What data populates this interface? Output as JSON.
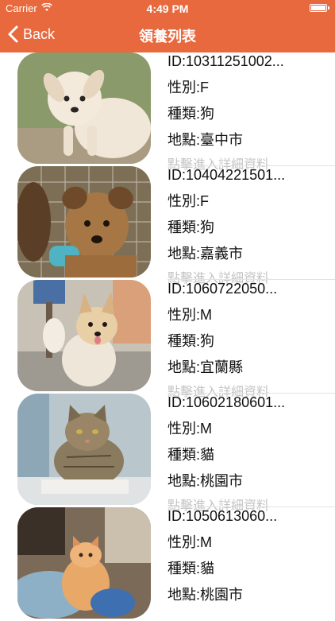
{
  "status_bar": {
    "carrier": "Carrier",
    "time": "4:49 PM"
  },
  "nav": {
    "back_label": "Back",
    "title": "領養列表"
  },
  "colors": {
    "accent": "#e8693e",
    "hint": "#c4c4c4"
  },
  "pets": [
    {
      "id": "ID:10311251002...",
      "sex": "性別:F",
      "kind": "種類:狗",
      "location": "地點:臺中市",
      "hint": "點擊進入詳細資料"
    },
    {
      "id": "ID:10404221501...",
      "sex": "性別:F",
      "kind": "種類:狗",
      "location": "地點:嘉義市",
      "hint": "點擊進入詳細資料"
    },
    {
      "id": "ID:1060722050...",
      "sex": "性別:M",
      "kind": "種類:狗",
      "location": "地點:宜蘭縣",
      "hint": "點擊進入詳細資料"
    },
    {
      "id": "ID:10602180601...",
      "sex": "性別:M",
      "kind": "種類:貓",
      "location": "地點:桃園市",
      "hint": "點擊進入詳細資料"
    },
    {
      "id": "ID:1050613060...",
      "sex": "性別:M",
      "kind": "種類:貓",
      "location": "地點:桃園市",
      "hint": ""
    }
  ]
}
